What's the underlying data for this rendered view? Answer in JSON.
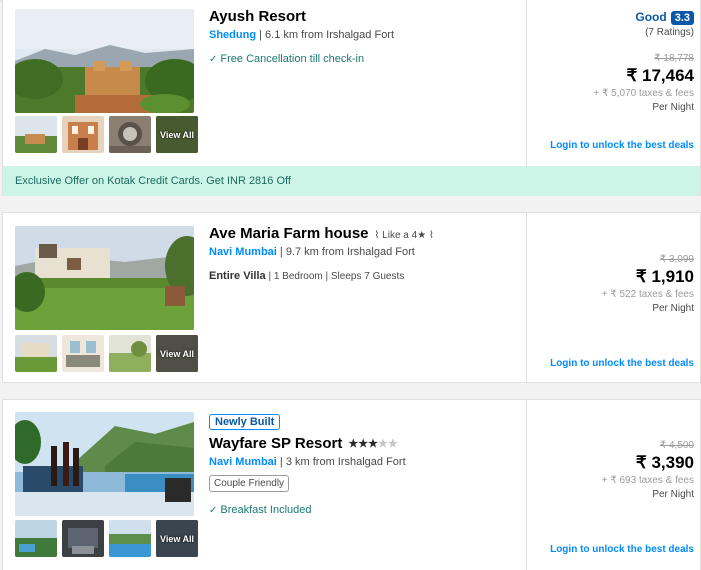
{
  "listings": [
    {
      "name": "Ayush Resort",
      "city": "Shedung",
      "distance": "| 6.1 km from Irshalgad Fort",
      "feature": "Free Cancellation till check-in",
      "rating_word": "Good",
      "rating_score": "3.3",
      "rating_count": "(7 Ratings)",
      "old_price": "₹ 18,778",
      "price": "₹ 17,464",
      "taxes": "+ ₹ 5,070 taxes & fees",
      "per_night": "Per Night",
      "login": "Login to unlock the best deals",
      "view_all": "View All",
      "offer": "Exclusive Offer on Kotak Credit Cards. Get INR 2816 Off"
    },
    {
      "name": "Ave Maria Farm house",
      "like_a": "Like a 4★",
      "city": "Navi Mumbai",
      "distance": "| 9.7 km from Irshalgad Fort",
      "type": "Entire Villa",
      "type_details": "| 1 Bedroom | Sleeps 7 Guests",
      "old_price": "₹ 3,099",
      "price": "₹ 1,910",
      "taxes": "+ ₹ 522 taxes & fees",
      "per_night": "Per Night",
      "login": "Login to unlock the best deals",
      "view_all": "View All"
    },
    {
      "badge": "Newly Built",
      "name": "Wayfare SP Resort",
      "star_rating": 3,
      "stars_on": "★★★",
      "stars_off": "★★",
      "city": "Navi Mumbai",
      "distance": "| 3 km from Irshalgad Fort",
      "tag": "Couple Friendly",
      "feature": "Breakfast Included",
      "old_price": "₹ 4,500",
      "price": "₹ 3,390",
      "taxes": "+ ₹ 693 taxes & fees",
      "per_night": "Per Night",
      "login": "Login to unlock the best deals",
      "view_all": "View All"
    }
  ],
  "colors": {
    "link_blue": "#008cff",
    "rating_blue": "#0b58a8",
    "offer_bg": "#cdf5e7",
    "feature_green": "#1a7971"
  }
}
